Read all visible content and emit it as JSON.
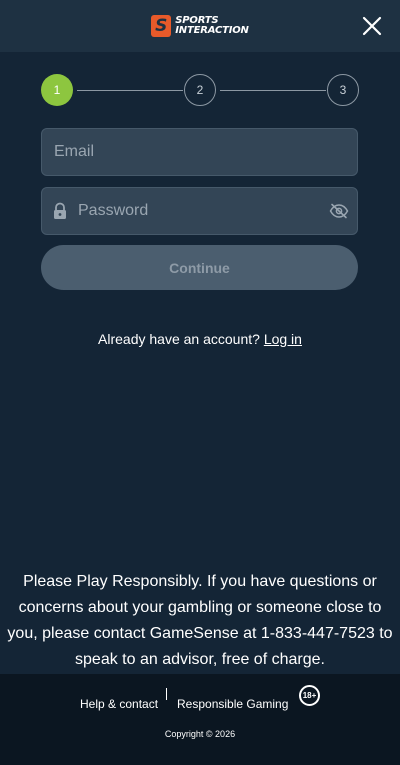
{
  "header": {
    "logo_line1": "SPORTS",
    "logo_line2": "INTERACTION",
    "logo_mark": "S",
    "close_icon": "close-icon"
  },
  "stepper": {
    "steps": [
      "1",
      "2",
      "3"
    ],
    "current_step": 1,
    "active_color": "#8dc63f"
  },
  "form": {
    "email_placeholder": "Email",
    "email_value": "",
    "password_placeholder": "Password",
    "password_value": "",
    "continue_label": "Continue"
  },
  "login": {
    "prompt": "Already have an account?",
    "link": "Log in"
  },
  "responsible_text": "Please Play Responsibly. If you have questions or concerns about your gambling or someone close to you, please contact GameSense at 1-833-447-7523 to speak to an advisor, free of charge.",
  "footer": {
    "help_link": "Help & contact",
    "responsible_link": "Responsible Gaming",
    "age_badge": "18+",
    "copyright": "Copyright © 2026"
  },
  "colors": {
    "background": "#142536",
    "header": "#1e3142",
    "footer": "#0b1621",
    "brand": "#e85a2a"
  }
}
